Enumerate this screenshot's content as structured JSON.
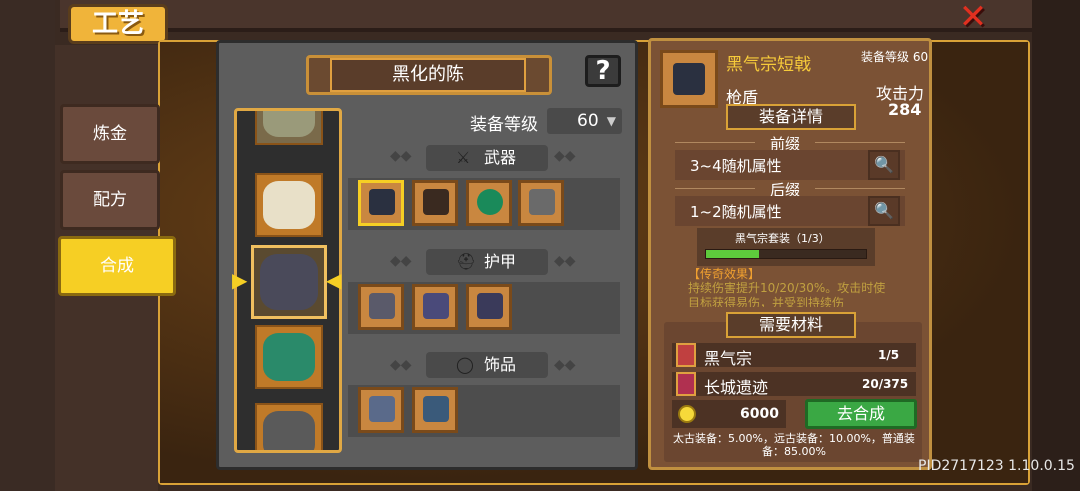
{
  "header": {
    "title": "工艺",
    "close_icon": "close-x-icon"
  },
  "sidebar": {
    "items": [
      {
        "label": "炼金",
        "active": false
      },
      {
        "label": "配方",
        "active": false
      },
      {
        "label": "合成",
        "active": true
      }
    ]
  },
  "left_panel": {
    "title": "黑化的陈",
    "help_label": "?",
    "level_label": "装备等级",
    "level_value": "60",
    "categories": [
      {
        "label": "武器",
        "icon": "sword-icon",
        "item_count": 4
      },
      {
        "label": "护甲",
        "icon": "helmet-icon",
        "item_count": 3
      },
      {
        "label": "饰品",
        "icon": "ring-icon",
        "item_count": 2
      }
    ]
  },
  "detail": {
    "name": "黑气宗短戟",
    "level_text": "装备等级 60",
    "type": "枪盾",
    "attack_label": "攻击力",
    "attack_value": "284",
    "details_banner": "装备详情",
    "prefix_label": "前缀",
    "prefix_text": "3~4随机属性",
    "suffix_label": "后缀",
    "suffix_text": "1~2随机属性",
    "set_label": "黑气宗套装（1/3）",
    "set_progress": 0.33,
    "legend_title": "【传奇效果】",
    "legend_text": "持续伤害提升10/20/30%。攻击时使目标获得易伤，并受到持续伤"
  },
  "materials": {
    "banner": "需要材料",
    "items": [
      {
        "name": "黑气宗",
        "count": "1/5"
      },
      {
        "name": "长城遗迹",
        "count": "20/375"
      }
    ],
    "gold": "6000",
    "craft_button": "去合成",
    "odds": "太古装备：5.00%，远古装备：10.00%，普通装备：85.00%"
  },
  "footer": {
    "build": "PID2717123 1.10.0.15"
  },
  "colors": {
    "accent": "#f6cf24",
    "frame": "#d9a237",
    "button_green": "#3aa844"
  }
}
